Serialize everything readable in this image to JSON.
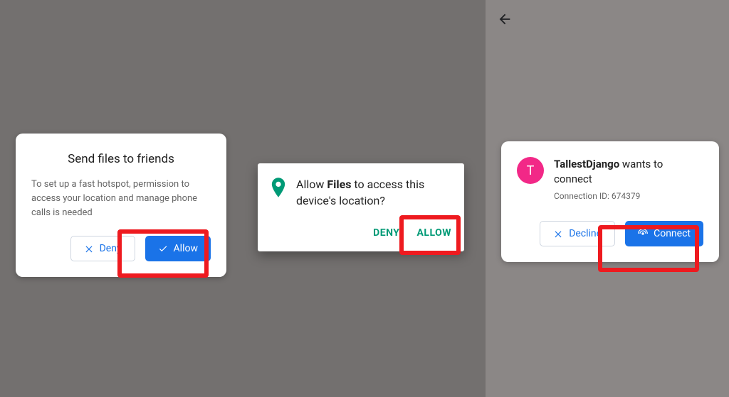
{
  "card1": {
    "title": "Send files to friends",
    "desc": "To set up a fast hotspot, permission to access your location and manage phone calls is needed",
    "deny": "Deny",
    "allow": "Allow"
  },
  "card2": {
    "prefix": "Allow ",
    "app": "Files",
    "suffix": " to access this device's location?",
    "deny": "DENY",
    "allow": "ALLOW"
  },
  "card3": {
    "avatarLetter": "T",
    "userName": "TallestDjango",
    "suffix": " wants to connect",
    "connIdLabel": "Connection ID: ",
    "connId": "674379",
    "decline": "Decline",
    "connect": "Connect"
  }
}
